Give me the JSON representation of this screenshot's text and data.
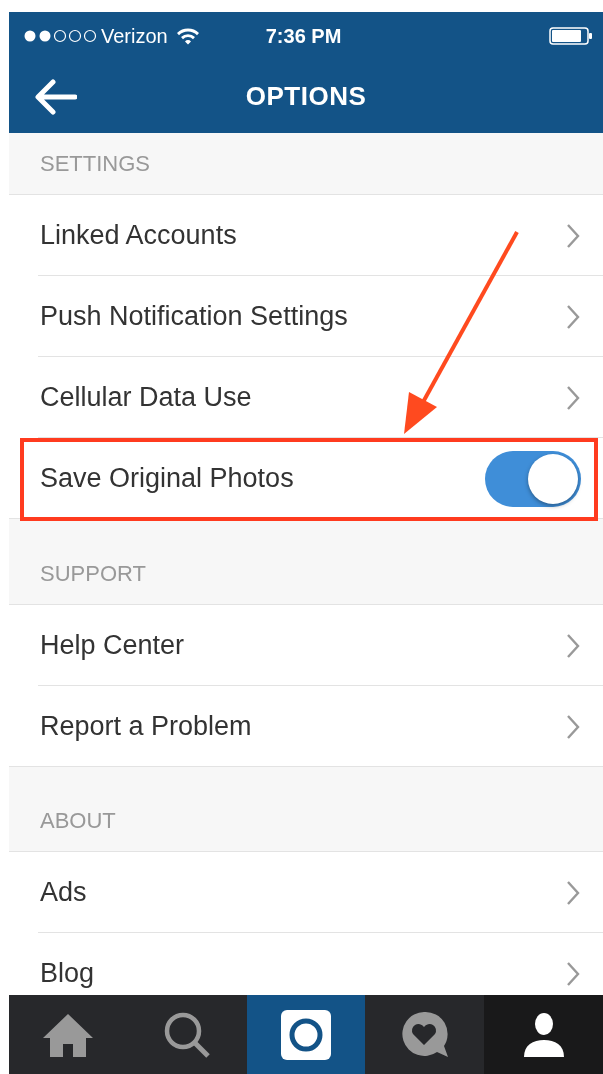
{
  "status_bar": {
    "carrier": "Verizon",
    "time": "7:36 PM"
  },
  "nav_bar": {
    "title": "OPTIONS"
  },
  "sections": [
    {
      "header": "SETTINGS",
      "rows": [
        {
          "label": "Linked Accounts",
          "kind": "link"
        },
        {
          "label": "Push Notification Settings",
          "kind": "link"
        },
        {
          "label": "Cellular Data Use",
          "kind": "link"
        },
        {
          "label": "Save Original Photos",
          "kind": "toggle",
          "on": true,
          "highlighted": true
        }
      ]
    },
    {
      "header": "SUPPORT",
      "rows": [
        {
          "label": "Help Center",
          "kind": "link"
        },
        {
          "label": "Report a Problem",
          "kind": "link"
        }
      ]
    },
    {
      "header": "ABOUT",
      "rows": [
        {
          "label": "Ads",
          "kind": "link"
        },
        {
          "label": "Blog",
          "kind": "link"
        }
      ]
    }
  ],
  "tab_bar": [
    {
      "kind": "home",
      "selected": false
    },
    {
      "kind": "search",
      "selected": false
    },
    {
      "kind": "camera",
      "selected": false
    },
    {
      "kind": "activity",
      "selected": false
    },
    {
      "kind": "profile",
      "selected": true
    }
  ]
}
